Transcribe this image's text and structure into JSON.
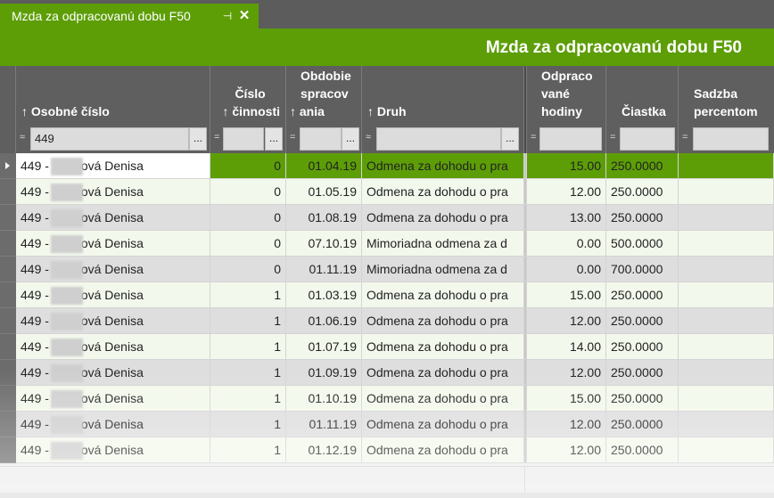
{
  "tab": {
    "label": "Mzda za odpracovanú dobu F50",
    "pin_glyph": "⊣",
    "close_glyph": "✕"
  },
  "header": {
    "title": "Mzda za odpracovanú dobu F50"
  },
  "columns": {
    "osobne": {
      "label": "↑ Osobné číslo",
      "filter_op": "≈",
      "filter_value": "449"
    },
    "cislo": {
      "label_1": "Číslo",
      "label_2": "↑ činnosti",
      "filter_op": "=",
      "filter_value": ""
    },
    "obdobie": {
      "label_1": "Obdobie",
      "label_2": "spracov",
      "label_3": "↑ ania",
      "filter_op": "=",
      "filter_value": ""
    },
    "druh": {
      "label": "↑ Druh",
      "filter_op": "≈",
      "filter_value": ""
    },
    "hodiny": {
      "label_1": "Odpraco",
      "label_2": "vané",
      "label_3": "hodiny",
      "filter_op": "=",
      "filter_value": ""
    },
    "ciastka": {
      "label": "Čiastka",
      "filter_op": "=",
      "filter_value": ""
    },
    "sadzba": {
      "label_1": "Sadzba",
      "label_2": "percentom",
      "filter_op": "=",
      "filter_value": ""
    },
    "dots": "..."
  },
  "rows": [
    {
      "id_prefix": "449 -",
      "name_suffix": "ová Denisa",
      "cislo": "0",
      "obdobie": "01.04.19",
      "druh": "Odmena za dohodu o pra",
      "hodiny": "15.00",
      "ciastka": "250.0000"
    },
    {
      "id_prefix": "449 -",
      "name_suffix": "ová Denisa",
      "cislo": "0",
      "obdobie": "01.05.19",
      "druh": "Odmena za dohodu o pra",
      "hodiny": "12.00",
      "ciastka": "250.0000"
    },
    {
      "id_prefix": "449 -",
      "name_suffix": "ová Denisa",
      "cislo": "0",
      "obdobie": "01.08.19",
      "druh": "Odmena za dohodu o pra",
      "hodiny": "13.00",
      "ciastka": "250.0000"
    },
    {
      "id_prefix": "449 -",
      "name_suffix": "ová Denisa",
      "cislo": "0",
      "obdobie": "07.10.19",
      "druh": "Mimoriadna odmena za d",
      "hodiny": "0.00",
      "ciastka": "500.0000"
    },
    {
      "id_prefix": "449 -",
      "name_suffix": "ová Denisa",
      "cislo": "0",
      "obdobie": "01.11.19",
      "druh": "Mimoriadna odmena za d",
      "hodiny": "0.00",
      "ciastka": "700.0000"
    },
    {
      "id_prefix": "449 -",
      "name_suffix": "ová Denisa",
      "cislo": "1",
      "obdobie": "01.03.19",
      "druh": "Odmena za dohodu o pra",
      "hodiny": "15.00",
      "ciastka": "250.0000"
    },
    {
      "id_prefix": "449 -",
      "name_suffix": "ová Denisa",
      "cislo": "1",
      "obdobie": "01.06.19",
      "druh": "Odmena za dohodu o pra",
      "hodiny": "12.00",
      "ciastka": "250.0000"
    },
    {
      "id_prefix": "449 -",
      "name_suffix": "ová Denisa",
      "cislo": "1",
      "obdobie": "01.07.19",
      "druh": "Odmena za dohodu o pra",
      "hodiny": "14.00",
      "ciastka": "250.0000"
    },
    {
      "id_prefix": "449 -",
      "name_suffix": "ová Denisa",
      "cislo": "1",
      "obdobie": "01.09.19",
      "druh": "Odmena za dohodu o pra",
      "hodiny": "12.00",
      "ciastka": "250.0000"
    },
    {
      "id_prefix": "449 -",
      "name_suffix": "ová Denisa",
      "cislo": "1",
      "obdobie": "01.10.19",
      "druh": "Odmena za dohodu o pra",
      "hodiny": "15.00",
      "ciastka": "250.0000"
    },
    {
      "id_prefix": "449 -",
      "name_suffix": "ová Denisa",
      "cislo": "1",
      "obdobie": "01.11.19",
      "druh": "Odmena za dohodu o pra",
      "hodiny": "12.00",
      "ciastka": "250.0000"
    },
    {
      "id_prefix": "449 -",
      "name_suffix": "ová Denisa",
      "cislo": "1",
      "obdobie": "01.12.19",
      "druh": "Odmena za dohodu o pra",
      "hodiny": "12.00",
      "ciastka": "250.0000"
    }
  ],
  "colors": {
    "accent": "#5d9e07",
    "header_dark": "#5f5f5f"
  }
}
